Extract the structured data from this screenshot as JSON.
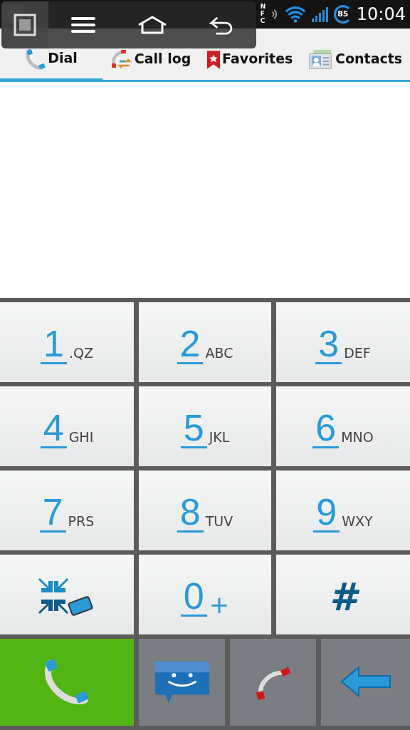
{
  "status_bar": {
    "nfc": "NFC",
    "battery": "85",
    "time": "10:04"
  },
  "tabs": [
    {
      "label": "Dial",
      "selected": true
    },
    {
      "label": "Call log",
      "selected": false
    },
    {
      "label": "Favorites",
      "selected": false
    },
    {
      "label": "Contacts",
      "selected": false
    }
  ],
  "keys": [
    {
      "kind": "digit",
      "digit": "1",
      "letters": ".QZ"
    },
    {
      "kind": "digit",
      "digit": "2",
      "letters": "ABC"
    },
    {
      "kind": "digit",
      "digit": "3",
      "letters": "DEF"
    },
    {
      "kind": "digit",
      "digit": "4",
      "letters": "GHI"
    },
    {
      "kind": "digit",
      "digit": "5",
      "letters": "JKL"
    },
    {
      "kind": "digit",
      "digit": "6",
      "letters": "MNO"
    },
    {
      "kind": "digit",
      "digit": "7",
      "letters": "PRS"
    },
    {
      "kind": "digit",
      "digit": "8",
      "letters": "TUV"
    },
    {
      "kind": "digit",
      "digit": "9",
      "letters": "WXY"
    },
    {
      "kind": "star"
    },
    {
      "kind": "digit",
      "digit": "0",
      "letters": "+"
    },
    {
      "kind": "symbol",
      "digit": "#"
    }
  ]
}
